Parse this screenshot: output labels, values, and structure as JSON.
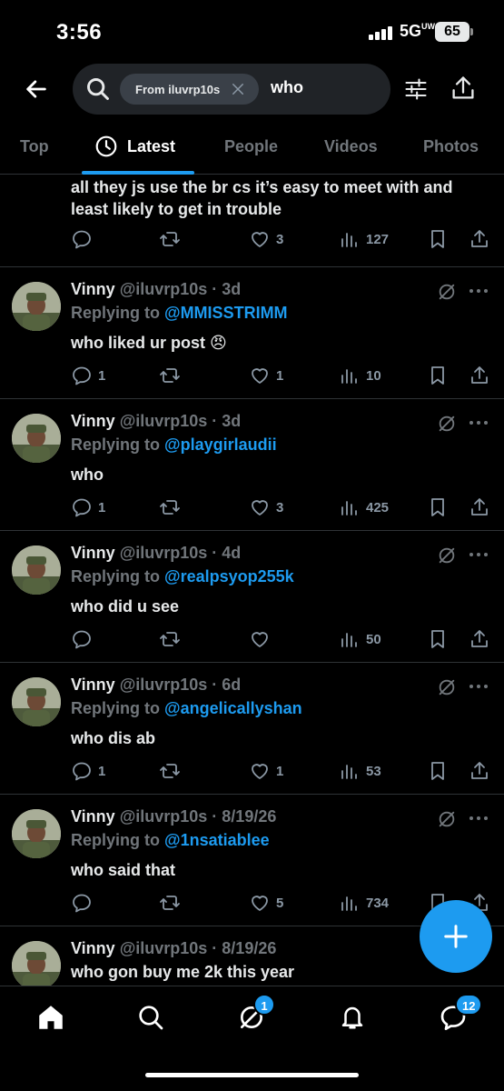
{
  "status": {
    "time": "3:56",
    "network": "5G",
    "network_sup": "UW",
    "battery": "65"
  },
  "search": {
    "chip_label": "From iluvrp10s",
    "query": "who"
  },
  "tabs": [
    {
      "label": "Top"
    },
    {
      "label": "Latest"
    },
    {
      "label": "People"
    },
    {
      "label": "Videos"
    },
    {
      "label": "Photos"
    }
  ],
  "partial_post": {
    "text_line1": "all they js use the br cs it’s easy to meet with and",
    "text_line2": "least likely to get in trouble",
    "likes": "3",
    "views": "127"
  },
  "posts": [
    {
      "name": "Vinny",
      "meta": "@iluvrp10s · 3d",
      "reply_prefix": "Replying to",
      "mention": "@MMISSTRIMM",
      "text": "who liked ur post 😠",
      "replies": "1",
      "reposts": "",
      "likes": "1",
      "views": "10"
    },
    {
      "name": "Vinny",
      "meta": "@iluvrp10s · 3d",
      "reply_prefix": "Replying to",
      "mention": "@playgirlaudii",
      "text": "who",
      "replies": "1",
      "reposts": "",
      "likes": "3",
      "views": "425"
    },
    {
      "name": "Vinny",
      "meta": "@iluvrp10s · 4d",
      "reply_prefix": "Replying to",
      "mention": "@realpsyop255k",
      "text": "who did u see",
      "replies": "",
      "reposts": "",
      "likes": "",
      "views": "50"
    },
    {
      "name": "Vinny",
      "meta": "@iluvrp10s · 6d",
      "reply_prefix": "Replying to",
      "mention": "@angelicallyshan",
      "text": "who dis ab",
      "replies": "1",
      "reposts": "",
      "likes": "1",
      "views": "53"
    },
    {
      "name": "Vinny",
      "meta": "@iluvrp10s · 8/19/26",
      "reply_prefix": "Replying to",
      "mention": "@1nsatiablee",
      "text": "who said that",
      "replies": "",
      "reposts": "",
      "likes": "5",
      "views": "734"
    },
    {
      "name": "Vinny",
      "meta": "@iluvrp10s · 8/19/26",
      "text": "who gon buy me 2k this year"
    }
  ],
  "nav": {
    "grok_badge": "1",
    "messages_badge": "12"
  },
  "icons": [
    "back-arrow-icon",
    "search-icon",
    "close-icon",
    "filter-icon",
    "share-icon",
    "clock-icon",
    "reply-icon",
    "repost-icon",
    "like-icon",
    "views-icon",
    "bookmark-icon",
    "grok-icon",
    "more-icon",
    "compose-plus-icon",
    "home-icon",
    "explore-icon",
    "notifications-icon",
    "messages-icon"
  ],
  "colors": {
    "accent": "#1d9bf0",
    "muted": "#71767b",
    "background": "#000000",
    "text": "#e7e9ea"
  }
}
